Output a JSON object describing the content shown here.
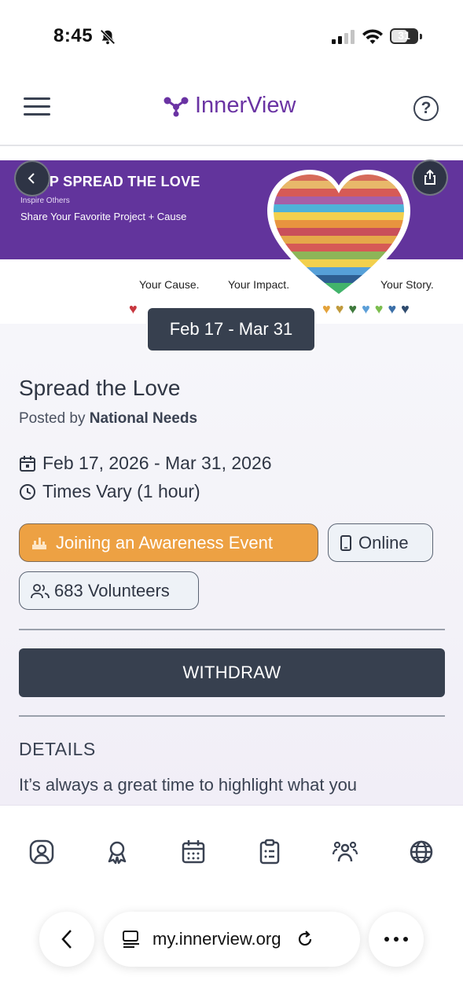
{
  "status_bar": {
    "time": "8:45",
    "battery": "31"
  },
  "header": {
    "app_name": "InnerView",
    "help_symbol": "?"
  },
  "banner": {
    "headline": "HELP SPREAD THE LOVE",
    "subline": "Inspire Others",
    "tagline": "Share Your Favorite Project + Cause",
    "tags": [
      "Your Cause.",
      "Your Impact.",
      "Your Story."
    ],
    "date_overlay": "Feb 17 - Mar 31"
  },
  "event": {
    "title": "Spread the Love",
    "posted_prefix": "Posted by",
    "posted_by": "National Needs",
    "date_range": "Feb 17, 2026 - Mar 31, 2026",
    "time": "Times Vary (1 hour)",
    "category": "Joining an Awareness Event",
    "location": "Online",
    "volunteers": "683 Volunteers",
    "action_button": "WITHDRAW",
    "details_heading": "DETAILS",
    "details_text": "It’s always a great time to highlight what you"
  },
  "bottom_nav": {
    "items": [
      "profile-icon",
      "award-icon",
      "calendar-icon",
      "clipboard-icon",
      "community-icon",
      "globe-icon"
    ]
  },
  "browser": {
    "url": "my.innerview.org"
  },
  "colors": {
    "brand_purple": "#6a33a3",
    "banner_purple": "#62349c",
    "dark_slate": "#37404f",
    "awareness_orange": "#eda143"
  }
}
